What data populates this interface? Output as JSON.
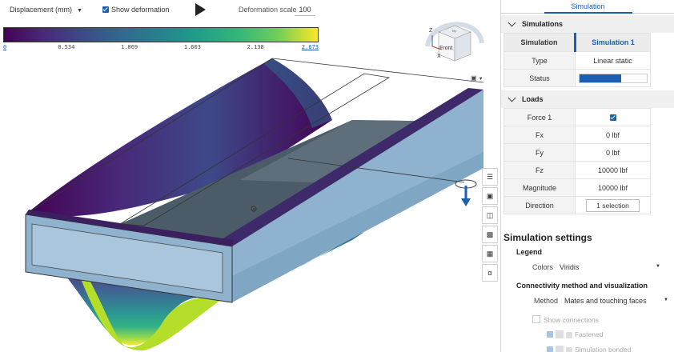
{
  "toolbar": {
    "quantity_label": "Displacement (mm)",
    "show_deformation_label": "Show deformation",
    "deformation_scale_label": "Deformation scale",
    "deformation_scale_value": "100"
  },
  "legend": {
    "ticks": [
      "0",
      "0.534",
      "1.069",
      "1.603",
      "2.138",
      "2.673"
    ],
    "colormap": [
      "#440154",
      "#482878",
      "#3e4989",
      "#31688e",
      "#26828e",
      "#1f9e89",
      "#35b779",
      "#6ece58",
      "#fde725"
    ]
  },
  "view_cube": {
    "front_label": "Front",
    "top_label": "Top",
    "z_label": "Z",
    "x_label": "X"
  },
  "panel": {
    "tab": "Simulation",
    "simulations": {
      "header": "Simulations",
      "col_left": "Simulation",
      "col_right": "Simulation 1",
      "rows": [
        {
          "label": "Type",
          "value": "Linear static"
        },
        {
          "label": "Status",
          "progress": 0.62
        }
      ]
    },
    "loads": {
      "header": "Loads",
      "force_label": "Force 1",
      "rows": [
        {
          "label": "Fx",
          "value": "0 lbf"
        },
        {
          "label": "Fy",
          "value": "0 lbf"
        },
        {
          "label": "Fz",
          "value": "10000 lbf"
        },
        {
          "label": "Magnitude",
          "value": "10000 lbf"
        }
      ],
      "direction_label": "Direction",
      "direction_value": "1 selection"
    },
    "settings": {
      "title": "Simulation settings",
      "legend_head": "Legend",
      "colors_label": "Colors",
      "colors_value": "Viridis",
      "connectivity_head": "Connectivity method and visualization",
      "method_label": "Method",
      "method_value": "Mates and touching faces",
      "show_connections": "Show connections",
      "fastened": "Fastened",
      "simulation_bonded": "Simulation bonded"
    }
  }
}
